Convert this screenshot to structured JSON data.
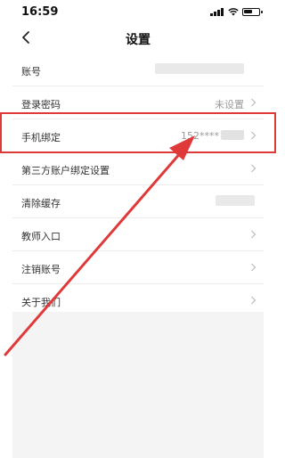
{
  "status_bar": {
    "time": "16:59"
  },
  "nav": {
    "title": "设置"
  },
  "rows": [
    {
      "label": "账号",
      "value": ""
    },
    {
      "label": "登录密码",
      "value": "未设置"
    },
    {
      "label": "手机绑定",
      "value": "152****"
    },
    {
      "label": "第三方账户绑定设置",
      "value": ""
    },
    {
      "label": "清除缓存",
      "value": ""
    },
    {
      "label": "教师入口",
      "value": ""
    },
    {
      "label": "注销账号",
      "value": ""
    },
    {
      "label": "关于我们",
      "value": ""
    }
  ],
  "colors": {
    "annotation_red": "#e0393a",
    "list_bg": "#ffffff",
    "footer_bg": "#f4f4f4"
  },
  "icons": [
    "back-arrow-icon",
    "signal-icon",
    "wifi-icon",
    "battery-icon",
    "chevron-right-icon"
  ]
}
